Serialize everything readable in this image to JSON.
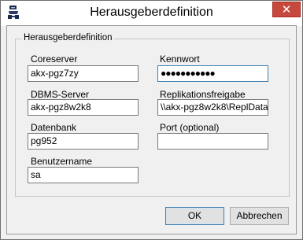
{
  "window": {
    "title": "Herausgeberdefinition",
    "close_label": "✕"
  },
  "group": {
    "legend": "Herausgeberdefinition"
  },
  "fields": {
    "coreserver": {
      "label": "Coreserver",
      "value": "akx-pgz7zy"
    },
    "kennwort": {
      "label": "Kennwort",
      "value": "●●●●●●●●●●●"
    },
    "dbms_server": {
      "label": "DBMS-Server",
      "value": "akx-pgz8w2k8"
    },
    "replikationsfreigabe": {
      "label": "Replikationsfreigabe",
      "value": "\\\\akx-pgz8w2k8\\ReplData"
    },
    "datenbank": {
      "label": "Datenbank",
      "value": "pg952"
    },
    "port": {
      "label": "Port (optional)",
      "value": ""
    },
    "benutzername": {
      "label": "Benutzername",
      "value": "sa"
    }
  },
  "buttons": {
    "ok": "OK",
    "cancel": "Abbrechen"
  },
  "colors": {
    "focus_border": "#3c7fb1",
    "close_button": "#c7483c"
  }
}
